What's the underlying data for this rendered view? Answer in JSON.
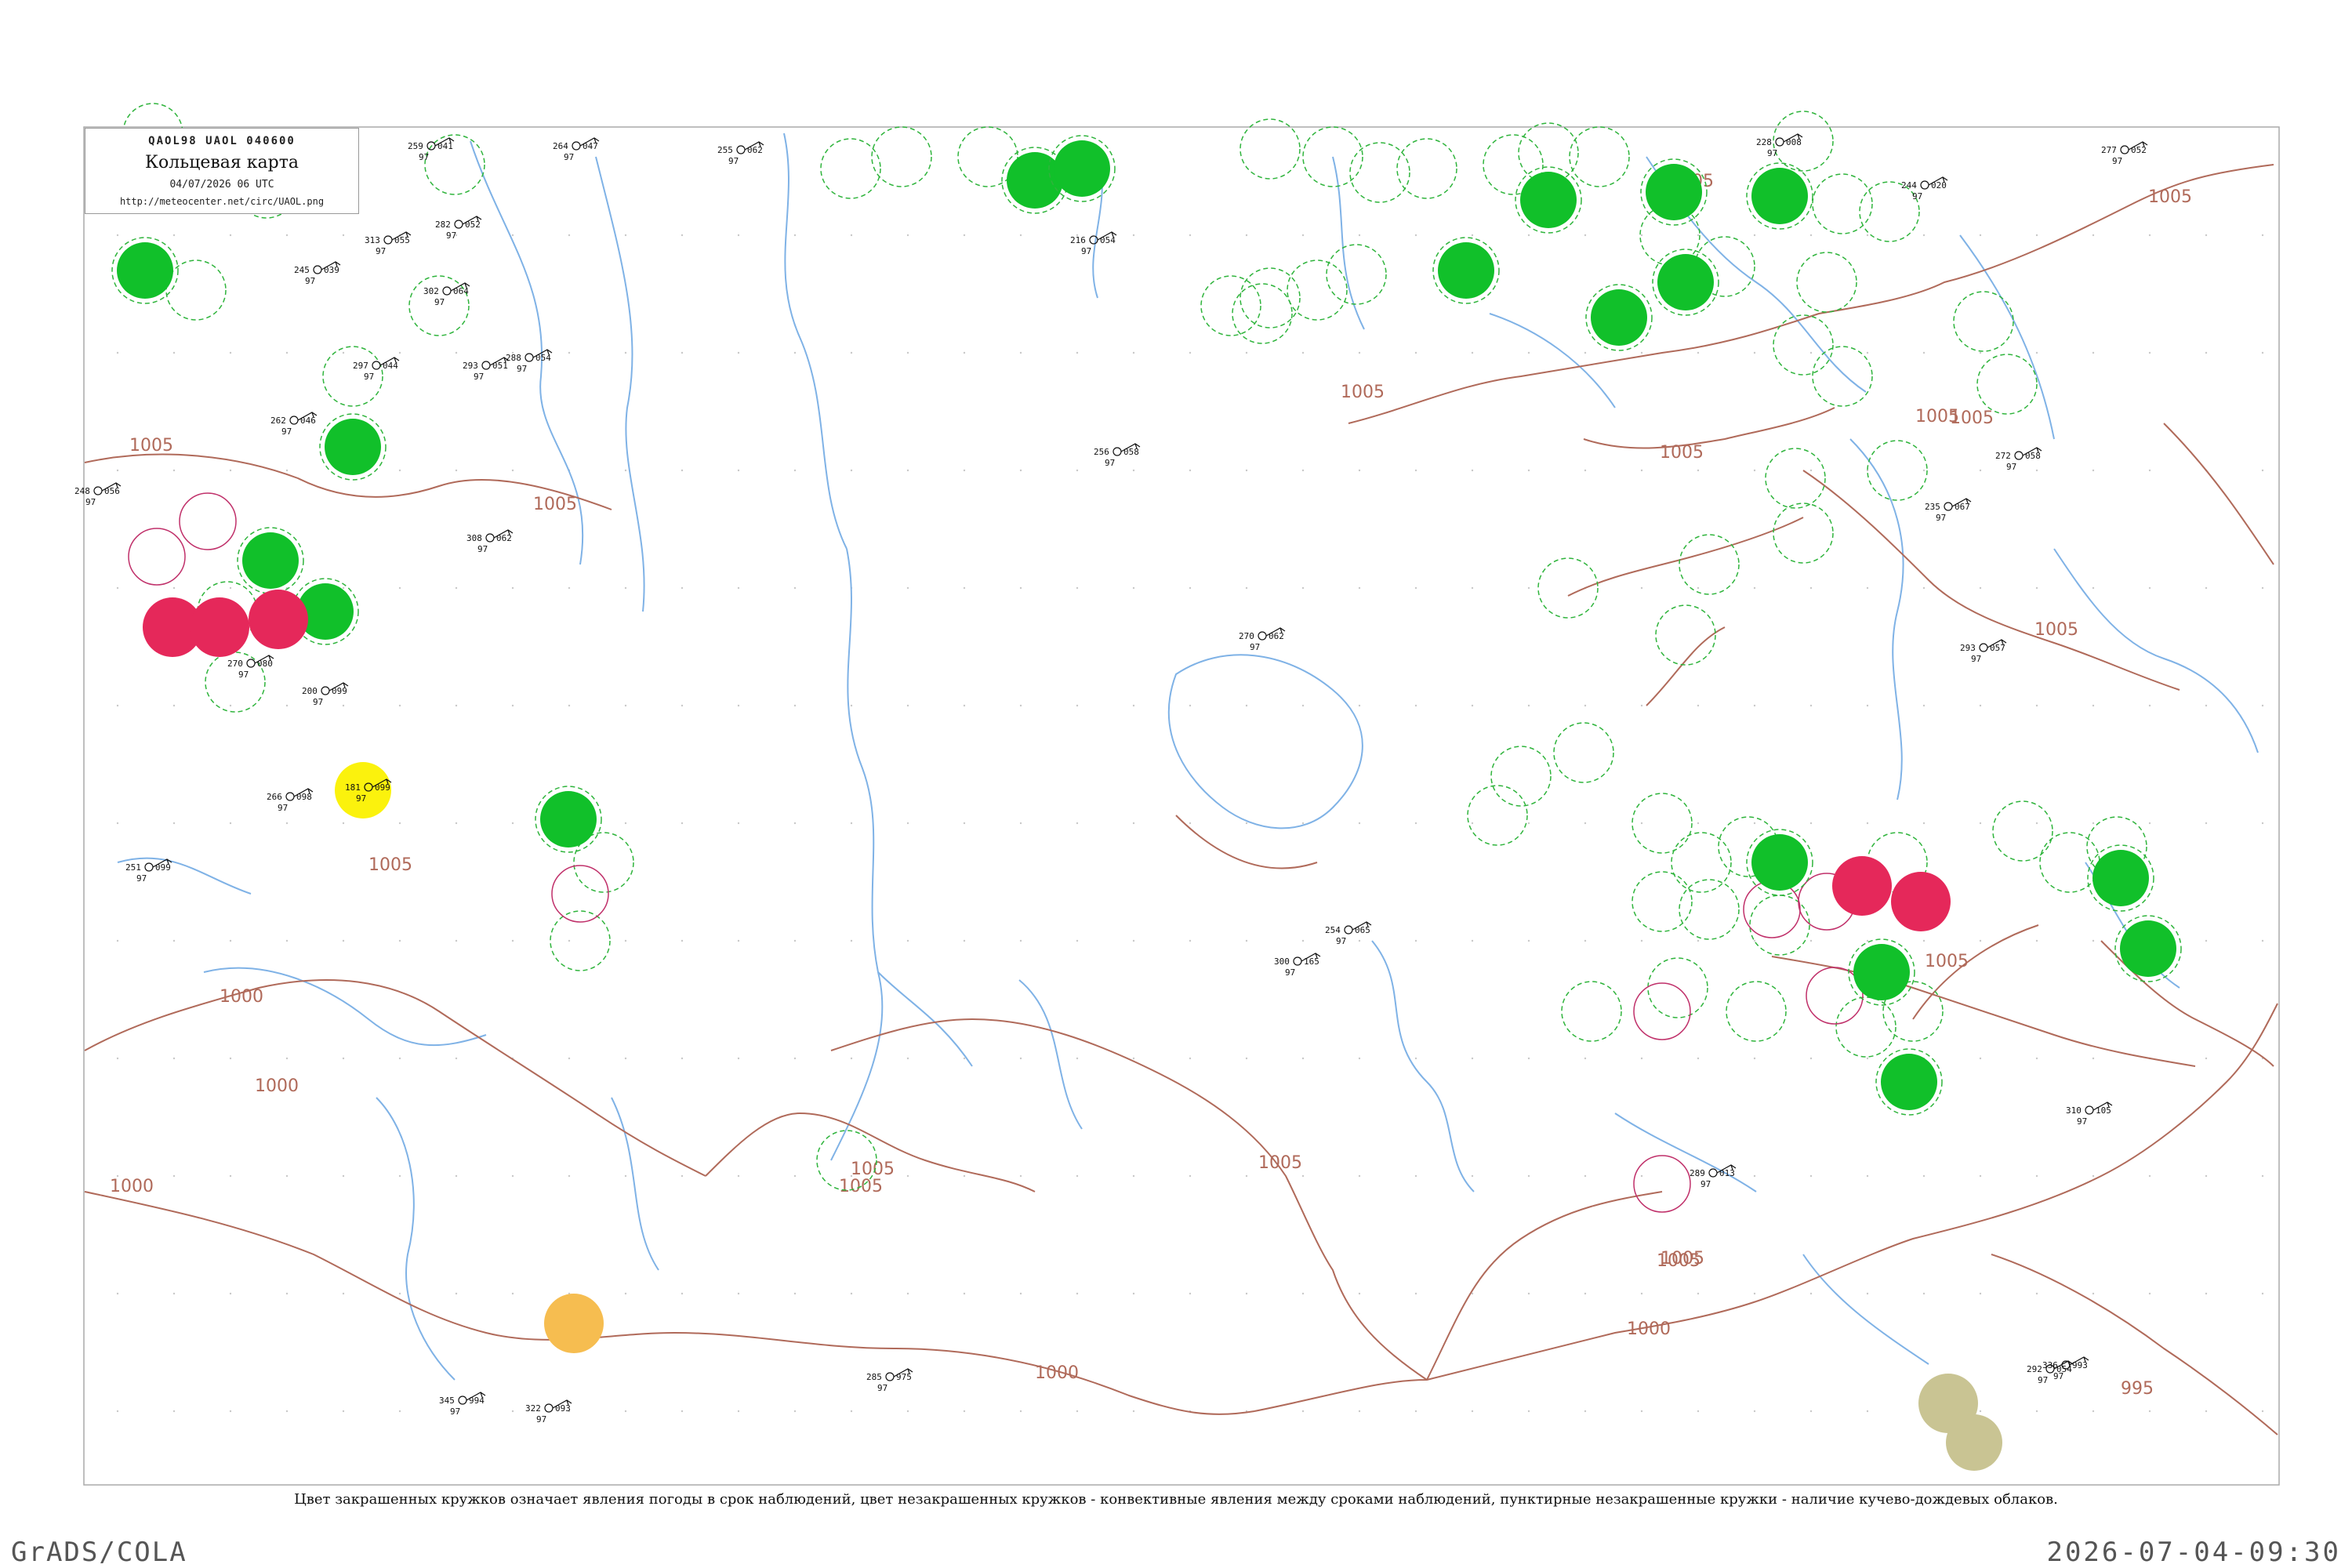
{
  "header": {
    "codes": "QAOL98  UAOL  040600",
    "title": "Кольцевая карта",
    "date": "04/07/2026 06 UTC",
    "url": "http://meteocenter.net/circ/UAOL.png"
  },
  "caption": "Цвет закрашенных кружков означает явления погоды в срок наблюдений, цвет незакрашенных кружков - конвективные явления между сроками наблюдений, пунктирные незакрашенные кружки - наличие кучево-дождевых облаков.",
  "footer": {
    "left": "GrADS/COLA",
    "right": "2026-07-04-09:30"
  },
  "colors": {
    "isobar": "#b06a5a",
    "river": "#7fb2e6",
    "station": "#111111",
    "legend_green": "#11c02a",
    "legend_red": "#e5285a",
    "legend_yellow": "#fbf20d",
    "legend_orange": "#f6bd50",
    "legend_olive": "#c9c493",
    "cb_dashed": "#2fb43c",
    "thunder_between": "#c0306a"
  },
  "isobar_labels": [
    "1005",
    "1005",
    "1005",
    "1005",
    "1005",
    "1005",
    "1005",
    "1005",
    "1005",
    "1000",
    "1000",
    "1000",
    "1000",
    "1005",
    "1005",
    "1005",
    "1000",
    "995",
    "1005",
    "1005",
    "1005",
    "1005"
  ],
  "stations": [
    {
      "t": "259",
      "p": "041",
      "m": "ESC"
    },
    {
      "t": "264",
      "p": "047",
      "m": "ESC"
    },
    {
      "t": "255",
      "p": "062",
      "m": "ESC"
    },
    {
      "t": "313",
      "p": "055",
      "m": "ESC"
    },
    {
      "t": "245",
      "p": "039",
      "m": "ESC"
    },
    {
      "t": "302",
      "p": "064",
      "m": "ESC"
    },
    {
      "t": "282",
      "p": "052",
      "m": "ESC"
    },
    {
      "t": "297",
      "p": "044",
      "m": "ESC"
    },
    {
      "t": "293",
      "p": "051",
      "m": "ESC"
    },
    {
      "t": "288",
      "p": "054",
      "m": "ESC"
    },
    {
      "t": "262",
      "p": "046",
      "m": "ESC"
    },
    {
      "t": "248",
      "p": "056",
      "m": "ESC"
    },
    {
      "t": "308",
      "p": "062",
      "m": "ESC"
    },
    {
      "t": "270",
      "p": "080",
      "m": "ESC"
    },
    {
      "t": "200",
      "p": "099",
      "m": "ESC"
    },
    {
      "t": "181",
      "p": "099",
      "m": "ESC"
    },
    {
      "t": "266",
      "p": "098",
      "m": "ESC"
    },
    {
      "t": "251",
      "p": "099",
      "m": "ESC"
    },
    {
      "t": "216",
      "p": "054",
      "m": "ESC"
    },
    {
      "t": "256",
      "p": "058",
      "m": "ESC"
    },
    {
      "t": "228",
      "p": "008",
      "m": "ESC"
    },
    {
      "t": "244",
      "p": "020",
      "m": "ESC"
    },
    {
      "t": "277",
      "p": "052",
      "m": "ESC"
    },
    {
      "t": "293",
      "p": "057",
      "m": "ESC"
    },
    {
      "t": "254",
      "p": "065",
      "m": "ESC"
    },
    {
      "t": "300",
      "p": "165",
      "m": "ESC"
    },
    {
      "t": "322",
      "p": "093",
      "m": "ESC"
    },
    {
      "t": "345",
      "p": "994",
      "m": "ESC"
    },
    {
      "t": "285",
      "p": "975",
      "m": "ESC"
    },
    {
      "t": "336",
      "p": "993",
      "m": "ESC"
    },
    {
      "t": "310",
      "p": "105",
      "m": "ESC"
    },
    {
      "t": "292",
      "p": "054",
      "m": "ESC"
    },
    {
      "t": "289",
      "p": "013",
      "m": "ESC"
    },
    {
      "t": "272",
      "p": "058",
      "m": "ESC"
    },
    {
      "t": "235",
      "p": "067",
      "m": "ESC"
    },
    {
      "t": "270",
      "p": "062",
      "m": "ESC"
    }
  ]
}
